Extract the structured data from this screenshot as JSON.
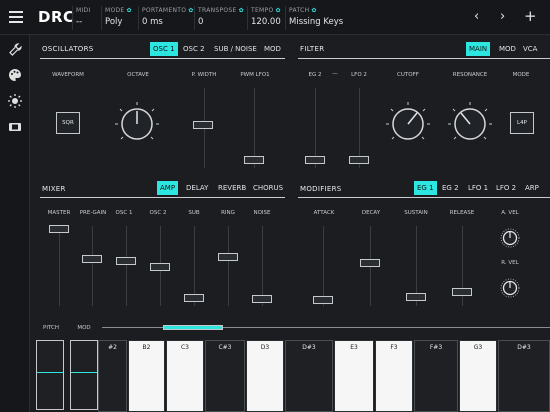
{
  "app": {
    "name": "DRC"
  },
  "header": {
    "midi": {
      "label": "MIDI",
      "value": "--"
    },
    "mode": {
      "label": "MODE",
      "value": "Poly"
    },
    "portamento": {
      "label": "PORTAMENTO",
      "value": "0 ms"
    },
    "transpose": {
      "label": "TRANSPOSE",
      "value": "0"
    },
    "tempo": {
      "label": "TEMPO",
      "value": "120.00"
    },
    "patch": {
      "label": "PATCH",
      "value": "Missing Keys"
    }
  },
  "oscillators": {
    "title": "OSCILLATORS",
    "tabs": [
      "OSC 1",
      "OSC 2",
      "SUB / NOISE",
      "MOD"
    ],
    "active_tab": "OSC 1",
    "waveform_label": "WAVEFORM",
    "waveform_value": "SQR",
    "octave_label": "OCTAVE",
    "pwidth_label": "P. WIDTH",
    "pwm_label": "PWM LFO1"
  },
  "filter": {
    "title": "FILTER",
    "tabs": [
      "MAIN",
      "MOD",
      "VCA"
    ],
    "active_tab": "MAIN",
    "eg2_label": "EG 2",
    "dash": "—",
    "lfo2_label": "LFO 2",
    "cutoff_label": "CUTOFF",
    "resonance_label": "RESONANCE",
    "mode_label": "MODE",
    "mode_value": "L4P"
  },
  "mixer": {
    "title": "MIXER",
    "tabs": [
      "AMP",
      "DELAY",
      "REVERB",
      "CHORUS"
    ],
    "active_tab": "AMP",
    "labels": {
      "master": "MASTER",
      "pregain": "PRE-GAIN",
      "osc1": "OSC 1",
      "osc2": "OSC 2",
      "sub": "SUB",
      "ring": "RING",
      "noise": "NOISE"
    }
  },
  "modifiers": {
    "title": "MODIFIERS",
    "tabs": [
      "EG 1",
      "EG 2",
      "LFO 1",
      "LFO 2",
      "ARP"
    ],
    "active_tab": "EG 1",
    "labels": {
      "attack": "ATTACK",
      "decay": "DECAY",
      "sustain": "SUSTAIN",
      "release": "RELEASE",
      "avel": "A. VEL",
      "rvel": "R. VEL"
    }
  },
  "keyboard": {
    "pitch_label": "PITCH",
    "mod_label": "MOD",
    "keys": [
      {
        "name": "#2",
        "type": "dark"
      },
      {
        "name": "B2",
        "type": "white"
      },
      {
        "name": "C3",
        "type": "white"
      },
      {
        "name": "C#3",
        "type": "dark"
      },
      {
        "name": "D3",
        "type": "white"
      },
      {
        "name": "D#3",
        "type": "dark"
      },
      {
        "name": "E3",
        "type": "white"
      },
      {
        "name": "F3",
        "type": "white"
      },
      {
        "name": "F#3",
        "type": "dark"
      },
      {
        "name": "G3",
        "type": "white"
      },
      {
        "name": "D#3",
        "type": "dark"
      }
    ]
  },
  "colors": {
    "accent": "#2ee6e0",
    "background": "#1b1d20",
    "bar": "#15171a"
  }
}
